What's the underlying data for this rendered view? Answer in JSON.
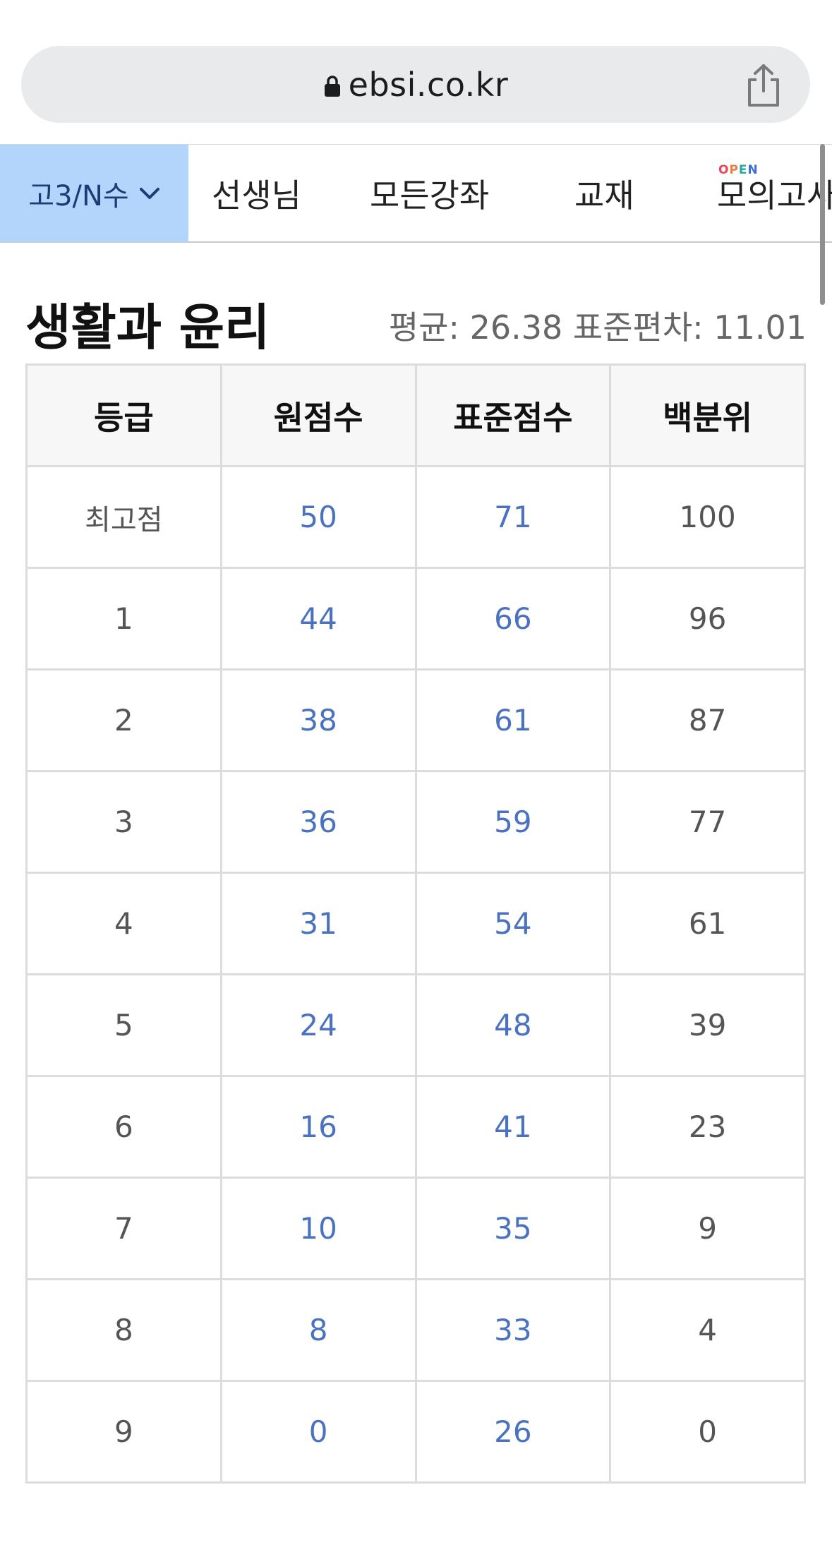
{
  "browser": {
    "url": "ebsi.co.kr"
  },
  "nav": {
    "grade_label": "고3/N수",
    "items": [
      "선생님",
      "모든강좌",
      "교재",
      "모의고사"
    ],
    "open_badge": "OPEN"
  },
  "subject": {
    "title": "생활과 윤리",
    "stats": "평균: 26.38 표준편차: 11.01"
  },
  "table": {
    "headers": [
      "등급",
      "원점수",
      "표준점수",
      "백분위"
    ],
    "rows": [
      [
        "최고점",
        "50",
        "71",
        "100"
      ],
      [
        "1",
        "44",
        "66",
        "96"
      ],
      [
        "2",
        "38",
        "61",
        "87"
      ],
      [
        "3",
        "36",
        "59",
        "77"
      ],
      [
        "4",
        "31",
        "54",
        "61"
      ],
      [
        "5",
        "24",
        "48",
        "39"
      ],
      [
        "6",
        "16",
        "41",
        "23"
      ],
      [
        "7",
        "10",
        "35",
        "9"
      ],
      [
        "8",
        "8",
        "33",
        "4"
      ],
      [
        "9",
        "0",
        "26",
        "0"
      ]
    ]
  },
  "colors": {
    "accent_nav": "#b3d4fb",
    "link_blue": "#4a72c0"
  }
}
